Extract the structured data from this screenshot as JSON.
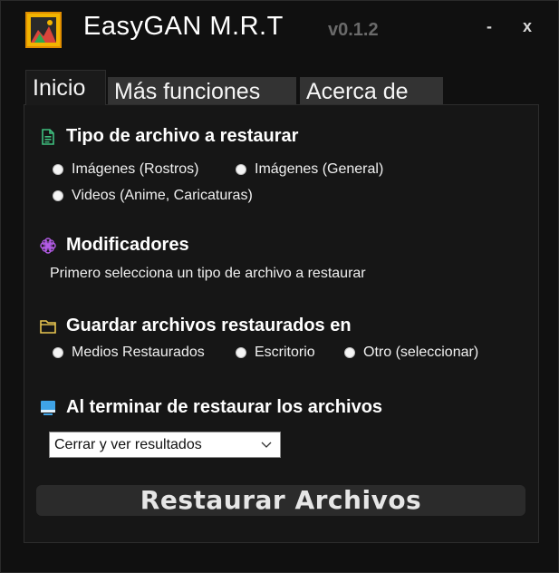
{
  "app": {
    "title": "EasyGAN M.R.T",
    "version": "v0.1.2",
    "logo_icon": "image-frame-logo-icon",
    "minimize_label": "-",
    "close_label": "x"
  },
  "tabs": [
    {
      "label": "Inicio",
      "selected": true
    },
    {
      "label": "Más funciones",
      "selected": false
    },
    {
      "label": "Acerca de",
      "selected": false
    }
  ],
  "sections": {
    "file_type": {
      "icon": "document-icon",
      "icon_color": "#3fbf7f",
      "title": "Tipo de archivo a restaurar",
      "options": [
        "Imágenes (Rostros)",
        "Imágenes (General)",
        "Videos (Anime, Caricaturas)"
      ]
    },
    "modifiers": {
      "icon": "flower-icon",
      "icon_color": "#b35ce6",
      "title": "Modificadores",
      "hint": "Primero selecciona un tipo de archivo a restaurar"
    },
    "save_location": {
      "icon": "folder-icon",
      "icon_color": "#e8c550",
      "title": "Guardar archivos restaurados en",
      "options": [
        "Medios Restaurados",
        "Escritorio",
        "Otro (seleccionar)"
      ]
    },
    "on_finish": {
      "icon": "monitor-icon",
      "icon_color": "#3fa3e6",
      "title": "Al terminar de restaurar los archivos",
      "selected_option": "Cerrar y ver resultados"
    }
  },
  "action": {
    "label": "Restaurar Archivos"
  }
}
